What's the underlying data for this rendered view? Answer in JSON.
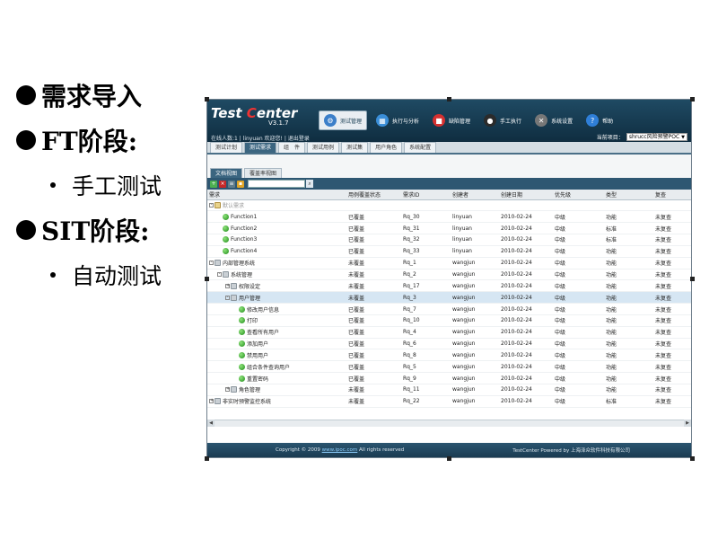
{
  "slide": {
    "bullets": [
      {
        "level": 1,
        "text": "需求导入"
      },
      {
        "level": 1,
        "text": "FT阶段:"
      },
      {
        "level": 2,
        "text": "手工测试"
      },
      {
        "level": 1,
        "text": "SIT阶段:"
      },
      {
        "level": 2,
        "text": "自动测试"
      }
    ]
  },
  "app": {
    "logo_part1": "Test ",
    "logo_part2": "C",
    "logo_part3": "enter",
    "version": "V3.1.7",
    "user_info": "在线人数:1 | linyuan 欢迎您! | 退出登录",
    "top_menu": [
      {
        "label": "测试管理",
        "icon": "gear-icon",
        "color": "#3c7fc9"
      },
      {
        "label": "执行与分析",
        "icon": "chart-icon",
        "color": "#3a8ed8"
      },
      {
        "label": "缺陷管理",
        "icon": "bug-icon",
        "color": "#d43030"
      },
      {
        "label": "手工执行",
        "icon": "run-icon",
        "color": "#2b2b2b"
      },
      {
        "label": "系统设置",
        "icon": "tools-icon",
        "color": "#777777"
      },
      {
        "label": "帮助",
        "icon": "help-icon",
        "color": "#2f7fd8"
      }
    ],
    "project_label": "当前项目：",
    "project_value": "shrucc风险预警POC",
    "sub_nav": [
      "测试计划",
      "测试需求",
      "组　件",
      "测试用例",
      "测试集",
      "用户角色",
      "系统配置"
    ],
    "view_tabs": [
      "文档视图",
      "覆盖率视图"
    ],
    "columns": [
      "需求",
      "用例覆盖状态",
      "需求ID",
      "创建者",
      "创建日期",
      "优先级",
      "类型",
      "复查"
    ],
    "rows": [
      {
        "name": "默认需求",
        "indent": 0,
        "icon": "folder",
        "expander": "-",
        "faded": true,
        "cells": [
          "",
          "",
          "",
          "",
          "",
          "",
          ""
        ]
      },
      {
        "name": "Function1",
        "indent": 1,
        "icon": "green",
        "expander": "",
        "cells": [
          "已覆盖",
          "Rq_30",
          "linyuan",
          "2010-02-24",
          "中级",
          "功能",
          "未复查"
        ]
      },
      {
        "name": "Function2",
        "indent": 1,
        "icon": "green",
        "expander": "",
        "cells": [
          "已覆盖",
          "Rq_31",
          "linyuan",
          "2010-02-24",
          "中级",
          "标准",
          "未复查"
        ]
      },
      {
        "name": "Function3",
        "indent": 1,
        "icon": "green",
        "expander": "",
        "cells": [
          "已覆盖",
          "Rq_32",
          "linyuan",
          "2010-02-24",
          "中级",
          "标准",
          "未复查"
        ]
      },
      {
        "name": "Function4",
        "indent": 1,
        "icon": "green",
        "expander": "",
        "cells": [
          "已覆盖",
          "Rq_33",
          "linyuan",
          "2010-02-24",
          "中级",
          "功能",
          "未复查"
        ]
      },
      {
        "name": "内部管理系统",
        "indent": 0,
        "icon": "group",
        "expander": "-",
        "cells": [
          "未覆盖",
          "Rq_1",
          "wangjun",
          "2010-02-24",
          "中级",
          "功能",
          "未复查"
        ]
      },
      {
        "name": "系统管理",
        "indent": 1,
        "icon": "group",
        "expander": "-",
        "cells": [
          "未覆盖",
          "Rq_2",
          "wangjun",
          "2010-02-24",
          "中级",
          "功能",
          "未复查"
        ]
      },
      {
        "name": "权限设定",
        "indent": 2,
        "icon": "group",
        "expander": "+",
        "cells": [
          "未覆盖",
          "Rq_17",
          "wangjun",
          "2010-02-24",
          "中级",
          "功能",
          "未复查"
        ]
      },
      {
        "name": "用户管理",
        "indent": 2,
        "icon": "group",
        "expander": "-",
        "selected": true,
        "cells": [
          "未覆盖",
          "Rq_3",
          "wangjun",
          "2010-02-24",
          "中级",
          "功能",
          "未复查"
        ]
      },
      {
        "name": "修改用户信息",
        "indent": 3,
        "icon": "green",
        "expander": "",
        "cells": [
          "已覆盖",
          "Rq_7",
          "wangjun",
          "2010-02-24",
          "中级",
          "功能",
          "未复查"
        ]
      },
      {
        "name": "打印",
        "indent": 3,
        "icon": "green",
        "expander": "",
        "cells": [
          "已覆盖",
          "Rq_10",
          "wangjun",
          "2010-02-24",
          "中级",
          "功能",
          "未复查"
        ]
      },
      {
        "name": "查看所有用户",
        "indent": 3,
        "icon": "green",
        "expander": "",
        "cells": [
          "已覆盖",
          "Rq_4",
          "wangjun",
          "2010-02-24",
          "中级",
          "功能",
          "未复查"
        ]
      },
      {
        "name": "添加用户",
        "indent": 3,
        "icon": "green",
        "expander": "",
        "cells": [
          "已覆盖",
          "Rq_6",
          "wangjun",
          "2010-02-24",
          "中级",
          "功能",
          "未复查"
        ]
      },
      {
        "name": "禁用用户",
        "indent": 3,
        "icon": "green",
        "expander": "",
        "cells": [
          "已覆盖",
          "Rq_8",
          "wangjun",
          "2010-02-24",
          "中级",
          "功能",
          "未复查"
        ]
      },
      {
        "name": "组合条件查询用户",
        "indent": 3,
        "icon": "green",
        "expander": "",
        "cells": [
          "已覆盖",
          "Rq_5",
          "wangjun",
          "2010-02-24",
          "中级",
          "功能",
          "未复查"
        ]
      },
      {
        "name": "重置密码",
        "indent": 3,
        "icon": "green",
        "expander": "",
        "cells": [
          "已覆盖",
          "Rq_9",
          "wangjun",
          "2010-02-24",
          "中级",
          "功能",
          "未复查"
        ]
      },
      {
        "name": "角色管理",
        "indent": 2,
        "icon": "group",
        "expander": "+",
        "cells": [
          "未覆盖",
          "Rq_11",
          "wangjun",
          "2010-02-24",
          "中级",
          "功能",
          "未复查"
        ]
      },
      {
        "name": "非实时预警监控系统",
        "indent": 0,
        "icon": "group",
        "expander": "+",
        "cells": [
          "未覆盖",
          "Rq_22",
          "wangjun",
          "2010-02-24",
          "中级",
          "标准",
          "未复查"
        ]
      }
    ],
    "footer_left_prefix": "Copyright © 2009 ",
    "footer_left_link": "www.ipoc.com",
    "footer_left_suffix": " All rights reserved",
    "footer_right": "TestCenter Powered by 上海泽众软件科技有限公司"
  }
}
